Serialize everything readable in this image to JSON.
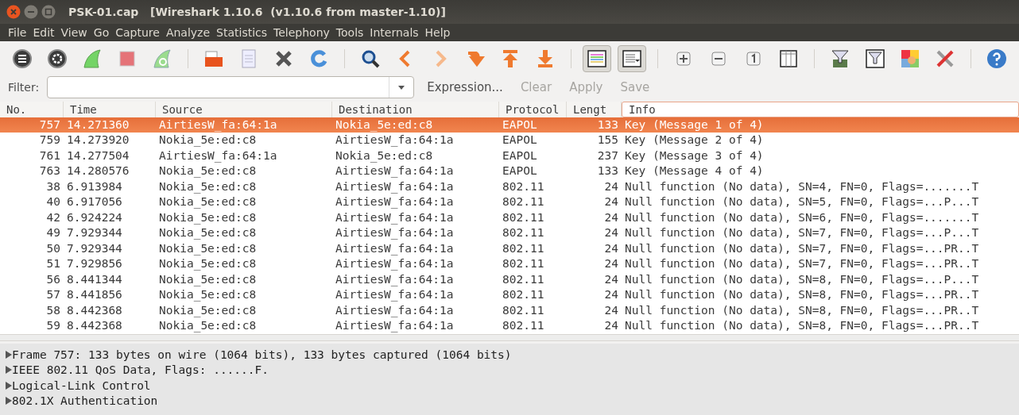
{
  "window": {
    "title": "PSK-01.cap   [Wireshark 1.10.6  (v1.10.6 from master-1.10)]"
  },
  "menu": [
    "File",
    "Edit",
    "View",
    "Go",
    "Capture",
    "Analyze",
    "Statistics",
    "Telephony",
    "Tools",
    "Internals",
    "Help"
  ],
  "toolbar": {
    "colorize_pressed": true,
    "autoscroll_pressed": true
  },
  "filter": {
    "label": "Filter:",
    "buttons": [
      {
        "label": "Expression...",
        "disabled": false
      },
      {
        "label": "Clear",
        "disabled": true
      },
      {
        "label": "Apply",
        "disabled": true
      },
      {
        "label": "Save",
        "disabled": true
      }
    ]
  },
  "table": {
    "columns": [
      {
        "label": "No.",
        "focused": false
      },
      {
        "label": "Time",
        "focused": false
      },
      {
        "label": "Source",
        "focused": false
      },
      {
        "label": "Destination",
        "focused": false
      },
      {
        "label": "Protocol",
        "focused": false
      },
      {
        "label": "Lengt",
        "focused": false
      },
      {
        "label": "Info",
        "focused": true
      }
    ],
    "rows": [
      {
        "selected": true,
        "cells": [
          "757",
          "14.271360",
          "AirtiesW_fa:64:1a",
          "Nokia_5e:ed:c8",
          "EAPOL",
          "133",
          "Key (Message 1 of 4)"
        ]
      },
      {
        "selected": false,
        "cells": [
          "759",
          "14.273920",
          "Nokia_5e:ed:c8",
          "AirtiesW_fa:64:1a",
          "EAPOL",
          "155",
          "Key (Message 2 of 4)"
        ]
      },
      {
        "selected": false,
        "cells": [
          "761",
          "14.277504",
          "AirtiesW_fa:64:1a",
          "Nokia_5e:ed:c8",
          "EAPOL",
          "237",
          "Key (Message 3 of 4)"
        ]
      },
      {
        "selected": false,
        "cells": [
          "763",
          "14.280576",
          "Nokia_5e:ed:c8",
          "AirtiesW_fa:64:1a",
          "EAPOL",
          "133",
          "Key (Message 4 of 4)"
        ]
      },
      {
        "selected": false,
        "cells": [
          "38",
          "6.913984",
          "Nokia_5e:ed:c8",
          "AirtiesW_fa:64:1a",
          "802.11",
          "24",
          "Null function (No data), SN=4, FN=0, Flags=.......T"
        ]
      },
      {
        "selected": false,
        "cells": [
          "40",
          "6.917056",
          "Nokia_5e:ed:c8",
          "AirtiesW_fa:64:1a",
          "802.11",
          "24",
          "Null function (No data), SN=5, FN=0, Flags=...P...T"
        ]
      },
      {
        "selected": false,
        "cells": [
          "42",
          "6.924224",
          "Nokia_5e:ed:c8",
          "AirtiesW_fa:64:1a",
          "802.11",
          "24",
          "Null function (No data), SN=6, FN=0, Flags=.......T"
        ]
      },
      {
        "selected": false,
        "cells": [
          "49",
          "7.929344",
          "Nokia_5e:ed:c8",
          "AirtiesW_fa:64:1a",
          "802.11",
          "24",
          "Null function (No data), SN=7, FN=0, Flags=...P...T"
        ]
      },
      {
        "selected": false,
        "cells": [
          "50",
          "7.929344",
          "Nokia_5e:ed:c8",
          "AirtiesW_fa:64:1a",
          "802.11",
          "24",
          "Null function (No data), SN=7, FN=0, Flags=...PR..T"
        ]
      },
      {
        "selected": false,
        "cells": [
          "51",
          "7.929856",
          "Nokia_5e:ed:c8",
          "AirtiesW_fa:64:1a",
          "802.11",
          "24",
          "Null function (No data), SN=7, FN=0, Flags=...PR..T"
        ]
      },
      {
        "selected": false,
        "cells": [
          "56",
          "8.441344",
          "Nokia_5e:ed:c8",
          "AirtiesW_fa:64:1a",
          "802.11",
          "24",
          "Null function (No data), SN=8, FN=0, Flags=...P...T"
        ]
      },
      {
        "selected": false,
        "cells": [
          "57",
          "8.441856",
          "Nokia_5e:ed:c8",
          "AirtiesW_fa:64:1a",
          "802.11",
          "24",
          "Null function (No data), SN=8, FN=0, Flags=...PR..T"
        ]
      },
      {
        "selected": false,
        "cells": [
          "58",
          "8.442368",
          "Nokia_5e:ed:c8",
          "AirtiesW_fa:64:1a",
          "802.11",
          "24",
          "Null function (No data), SN=8, FN=0, Flags=...PR..T"
        ]
      },
      {
        "selected": false,
        "cells": [
          "59",
          "8.442368",
          "Nokia_5e:ed:c8",
          "AirtiesW_fa:64:1a",
          "802.11",
          "24",
          "Null function (No data), SN=8, FN=0, Flags=...PR..T"
        ]
      }
    ]
  },
  "details": [
    {
      "label": "Frame 757: 133 bytes on wire (1064 bits), 133 bytes captured (1064 bits)",
      "expanded": false
    },
    {
      "label": "IEEE 802.11 QoS Data, Flags: ......F.",
      "expanded": false
    },
    {
      "label": "Logical-Link Control",
      "expanded": false
    },
    {
      "label": "802.1X Authentication",
      "expanded": false
    }
  ]
}
